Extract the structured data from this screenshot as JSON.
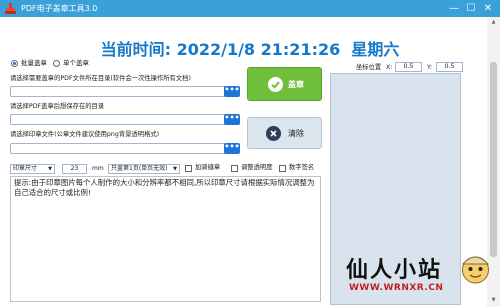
{
  "window": {
    "title": "PDF电子盖章工具3.0",
    "controls": {
      "minimize": "—",
      "maximize": "☐",
      "close": "✕"
    }
  },
  "clock": {
    "label": "当前时间:",
    "date": "2022/1/8",
    "time": "21:21:26",
    "weekday": "星期六"
  },
  "mode": {
    "batch_label": "批量盖章",
    "single_label": "单个盖章",
    "selected": "批量盖章"
  },
  "inputs": {
    "pdf_source": {
      "label": "请选择需要盖章的PDF文件所在目录(软件会一次性操作所有文档)",
      "value": ""
    },
    "output_dir": {
      "label": "请选择PDF盖章后想保存在的目录",
      "value": ""
    },
    "stamp_file": {
      "label": "请选择印章文件(公章文件建议使用png背景透明格式)",
      "value": ""
    },
    "browse_label": "•••"
  },
  "actions": {
    "stamp_label": "盖章",
    "clear_label": "清除"
  },
  "coords": {
    "label": "坐标位置",
    "x_label": "X:",
    "x_value": "0.5",
    "y_label": "Y:",
    "y_value": "0.5"
  },
  "options": {
    "size_mode": "印章尺寸",
    "size_value": "23",
    "size_unit": "mm",
    "page_mode": "只盖第1页(单页无效)",
    "seam_label": "加骑缝章",
    "seam_checked": false,
    "opacity_label": "调整透明度",
    "opacity_checked": false,
    "digital_sign_label": "数字签名",
    "digital_sign_checked": false
  },
  "tip": "    提示:由于印章图片每个人制作的大小和分辨率都不相同,所以印章尺寸请根据实际情况调整为自己适合的尺寸或比例!",
  "watermark": {
    "name": "仙人小站",
    "url": "WWW.WRNXR.CN"
  },
  "colors": {
    "titlebar": "#3aa0d8",
    "accent_blue": "#1678c9",
    "stamp_green": "#6fbe3c",
    "browse_blue": "#1f74d4"
  }
}
